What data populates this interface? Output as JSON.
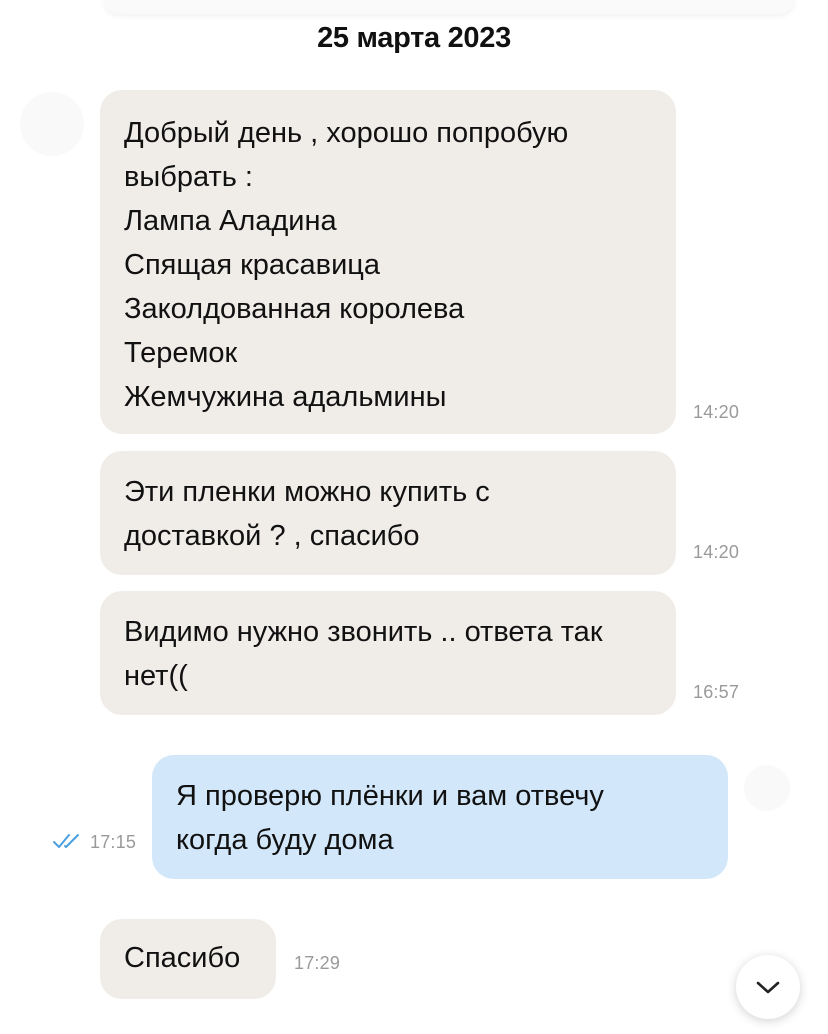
{
  "date_header": "25 марта 2023",
  "messages": [
    {
      "direction": "incoming",
      "text": "Добрый день , хорошо попробую\nвыбрать :\nЛампа Аладина\nСпящая красавица\nЗаколдованная королева\nТеремок\nЖемчужина адальмины",
      "time": "14:20"
    },
    {
      "direction": "incoming",
      "text": "Эти пленки можно купить с\nдоставкой ? , спасибо",
      "time": "14:20"
    },
    {
      "direction": "incoming",
      "text": "Видимо нужно звонить .. ответа так\nнет((",
      "time": "16:57"
    },
    {
      "direction": "outgoing",
      "text": "Я проверю плёнки и вам отвечу\nкогда буду дома",
      "time": "17:15",
      "status": "read"
    },
    {
      "direction": "incoming",
      "text": "Спасибо",
      "time": "17:29"
    }
  ],
  "icons": {
    "read_status": "double-check-icon",
    "scroll_down": "chevron-down-icon"
  },
  "colors": {
    "incoming_bubble": "#f0ede9",
    "outgoing_bubble": "#d2e8fa",
    "read_check": "#4a9fe0",
    "timestamp": "#9a9a9a"
  }
}
